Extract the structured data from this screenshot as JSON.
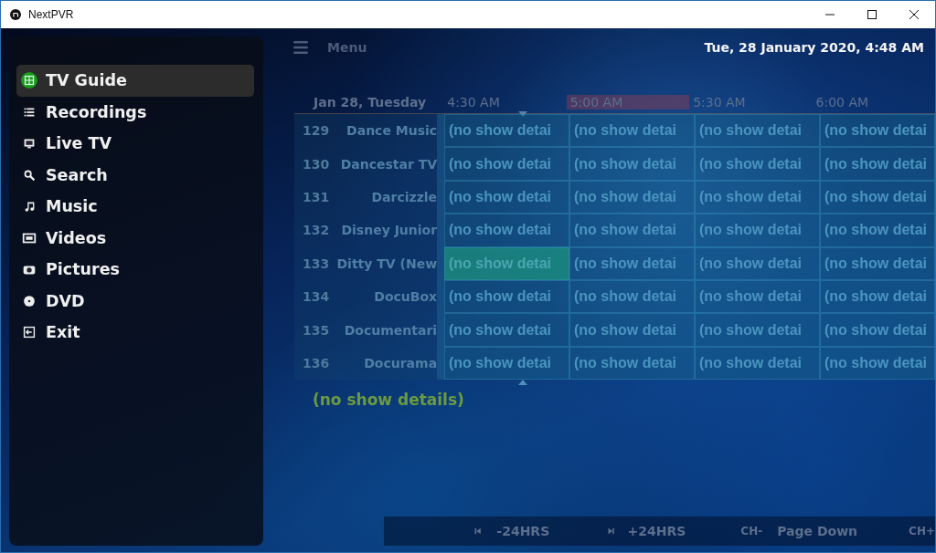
{
  "window": {
    "title": "NextPVR"
  },
  "sidebar": {
    "items": [
      {
        "label": "TV Guide",
        "selected": true
      },
      {
        "label": "Recordings",
        "selected": false
      },
      {
        "label": "Live TV",
        "selected": false
      },
      {
        "label": "Search",
        "selected": false
      },
      {
        "label": "Music",
        "selected": false
      },
      {
        "label": "Videos",
        "selected": false
      },
      {
        "label": "Pictures",
        "selected": false
      },
      {
        "label": "DVD",
        "selected": false
      },
      {
        "label": "Exit",
        "selected": false
      }
    ]
  },
  "header": {
    "menu_label": "Menu",
    "datetime": "Tue, 28 January 2020, 4:48 AM"
  },
  "guide": {
    "date_label": "Jan 28, Tuesday",
    "times": [
      {
        "label": "4:30 AM",
        "current": false
      },
      {
        "label": "5:00 AM",
        "current": true
      },
      {
        "label": "5:30 AM",
        "current": false
      },
      {
        "label": "6:00 AM",
        "current": false
      }
    ],
    "rows": [
      {
        "number": "129",
        "name": "Dance Music",
        "cells": [
          {
            "text": "(no show detai",
            "selected": false
          },
          {
            "text": "(no show detai",
            "selected": false
          },
          {
            "text": "(no show detai",
            "selected": false
          },
          {
            "text": "(no show detai",
            "selected": false
          }
        ]
      },
      {
        "number": "130",
        "name": "Dancestar TV",
        "cells": [
          {
            "text": "(no show detai",
            "selected": false
          },
          {
            "text": "(no show detai",
            "selected": false
          },
          {
            "text": "(no show detai",
            "selected": false
          },
          {
            "text": "(no show detai",
            "selected": false
          }
        ]
      },
      {
        "number": "131",
        "name": "Darcizzle",
        "cells": [
          {
            "text": "(no show detai",
            "selected": false
          },
          {
            "text": "(no show detai",
            "selected": false
          },
          {
            "text": "(no show detai",
            "selected": false
          },
          {
            "text": "(no show detai",
            "selected": false
          }
        ]
      },
      {
        "number": "132",
        "name": "Disney Junior",
        "cells": [
          {
            "text": "(no show detai",
            "selected": false
          },
          {
            "text": "(no show detai",
            "selected": false
          },
          {
            "text": "(no show detai",
            "selected": false
          },
          {
            "text": "(no show detai",
            "selected": false
          }
        ]
      },
      {
        "number": "133",
        "name": "Ditty TV (New",
        "cells": [
          {
            "text": "(no show detai",
            "selected": true
          },
          {
            "text": "(no show detai",
            "selected": false
          },
          {
            "text": "(no show detai",
            "selected": false
          },
          {
            "text": "(no show detai",
            "selected": false
          }
        ]
      },
      {
        "number": "134",
        "name": "DocuBox",
        "cells": [
          {
            "text": "(no show detai",
            "selected": false
          },
          {
            "text": "(no show detai",
            "selected": false
          },
          {
            "text": "(no show detai",
            "selected": false
          },
          {
            "text": "(no show detai",
            "selected": false
          }
        ]
      },
      {
        "number": "135",
        "name": "Documentari",
        "cells": [
          {
            "text": "(no show detai",
            "selected": false
          },
          {
            "text": "(no show detai",
            "selected": false
          },
          {
            "text": "(no show detai",
            "selected": false
          },
          {
            "text": "(no show detai",
            "selected": false
          }
        ]
      },
      {
        "number": "136",
        "name": "Docurama",
        "cells": [
          {
            "text": "(no show detai",
            "selected": false
          },
          {
            "text": "(no show detai",
            "selected": false
          },
          {
            "text": "(no show detai",
            "selected": false
          },
          {
            "text": "(no show detai",
            "selected": false
          }
        ]
      }
    ],
    "details": "(no show details)"
  },
  "footer": {
    "items": [
      "-24HRS",
      "+24HRS",
      "CH-",
      "Page Down",
      "CH+"
    ]
  }
}
